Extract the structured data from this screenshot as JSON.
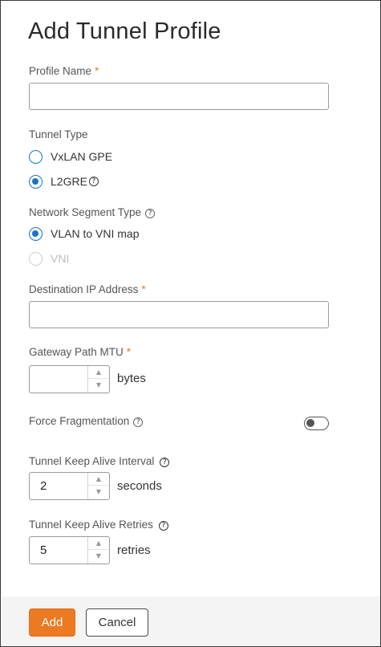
{
  "title": "Add Tunnel Profile",
  "required_mark": "*",
  "help_glyph": "?",
  "profile_name": {
    "label": "Profile Name",
    "value": ""
  },
  "tunnel_type": {
    "label": "Tunnel Type",
    "options": [
      {
        "label": "VxLAN GPE",
        "selected": false
      },
      {
        "label": "L2GRE",
        "selected": true
      }
    ]
  },
  "network_segment_type": {
    "label": "Network Segment Type",
    "options": [
      {
        "label": "VLAN to VNI map",
        "selected": true
      },
      {
        "label": "VNI",
        "selected": false,
        "disabled": true
      }
    ]
  },
  "destination_ip": {
    "label": "Destination IP Address",
    "value": ""
  },
  "gateway_mtu": {
    "label": "Gateway Path MTU",
    "value": "",
    "unit": "bytes"
  },
  "force_fragmentation": {
    "label": "Force Fragmentation",
    "enabled": false
  },
  "keep_alive_interval": {
    "label": "Tunnel Keep Alive Interval",
    "value": "2",
    "unit": "seconds"
  },
  "keep_alive_retries": {
    "label": "Tunnel Keep Alive Retries",
    "value": "5",
    "unit": "retries"
  },
  "stepper_arrows": {
    "up": "▲",
    "down": "▼"
  },
  "footer": {
    "add_label": "Add",
    "cancel_label": "Cancel"
  },
  "colors": {
    "accent": "#1a73c7",
    "primary_button": "#ec7a23",
    "required": "#e07a2c"
  }
}
